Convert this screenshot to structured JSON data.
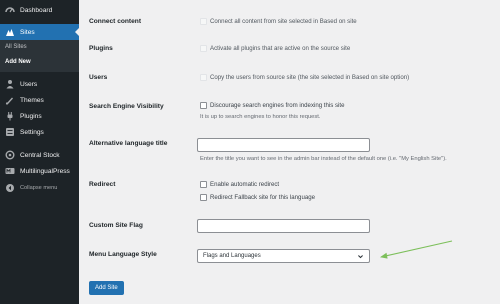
{
  "sidebar": {
    "dashboard": "Dashboard",
    "sites": "Sites",
    "submenu": {
      "all_sites": "All Sites",
      "add_new": "Add New"
    },
    "users": "Users",
    "themes": "Themes",
    "plugins": "Plugins",
    "settings": "Settings",
    "central_stock": "Central Stock",
    "multilingualpress": "MultilingualPress",
    "collapse": "Collapse menu"
  },
  "form": {
    "connect_content": {
      "label": "Connect content",
      "option": "Connect all content from site selected in Based on site"
    },
    "plugins": {
      "label": "Plugins",
      "option": "Activate all plugins that are active on the source site"
    },
    "users": {
      "label": "Users",
      "option": "Copy the users from source site (the site selected in Based on site option)"
    },
    "search_engine": {
      "label": "Search Engine Visibility",
      "option": "Discourage search engines from indexing this site",
      "description": "It is up to search engines to honor this request."
    },
    "alt_language_title": {
      "label": "Alternative language title",
      "value": "",
      "description": "Enter the title you want to see in the admin bar instead of the default one (i.e. \"My English Site\")."
    },
    "redirect": {
      "label": "Redirect",
      "option1": "Enable automatic redirect",
      "option2": "Redirect Fallback site for this language"
    },
    "custom_flag": {
      "label": "Custom Site Flag",
      "value": ""
    },
    "menu_language_style": {
      "label": "Menu Language Style",
      "selected": "Flags and Languages"
    },
    "submit": "Add Site"
  },
  "colors": {
    "sidebar_bg": "#1d2327",
    "submenu_bg": "#2c3338",
    "accent": "#2271b1",
    "page_bg": "#f0f0f1",
    "arrow": "#7cbf5a"
  }
}
